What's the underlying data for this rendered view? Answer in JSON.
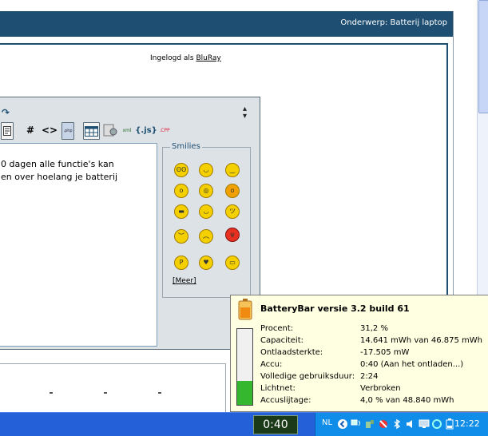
{
  "header": {
    "subject": "Onderwerp: Batterij laptop"
  },
  "login": {
    "prefix": "Ingelogd als",
    "user": "BluRay"
  },
  "editor": {
    "text_lines": [
      "0 dagen alle functie's kan",
      "en over hoelang je batterij"
    ],
    "toolbar": [
      "#",
      "<>",
      ".php",
      "table",
      "gear",
      "xml",
      "{.js}",
      ".CPP"
    ],
    "smilies_legend": "Smilies",
    "smilies_more": "[Meer]"
  },
  "tooltip": {
    "title": "BatteryBar versie 3.2 build 61",
    "rows": [
      {
        "label": "Procent:",
        "value": "31,2 %"
      },
      {
        "label": "Capaciteit:",
        "value": "14.641 mWh van 46.875 mWh"
      },
      {
        "label": "Ontlaadsterkte:",
        "value": "-17.505 mW"
      },
      {
        "label": "Accu:",
        "value": "0:40 (Aan het ontladen...)"
      },
      {
        "label": "Volledige gebruiksduur:",
        "value": "2:24"
      },
      {
        "label": "Lichtnet:",
        "value": "Verbroken"
      },
      {
        "label": "Accuslijtage:",
        "value": "4,0 % van 48.840 mWh"
      }
    ],
    "battery_level": 0.312,
    "battery_color": "#35b72f"
  },
  "taskbar": {
    "battery_time": "0:40",
    "language": "NL",
    "clock": "12:22"
  },
  "colors": {
    "header": "#1e4f73",
    "taskbar": "#2460d8",
    "tray": "#0f8de8",
    "tooltip_bg": "#ffffe1"
  }
}
